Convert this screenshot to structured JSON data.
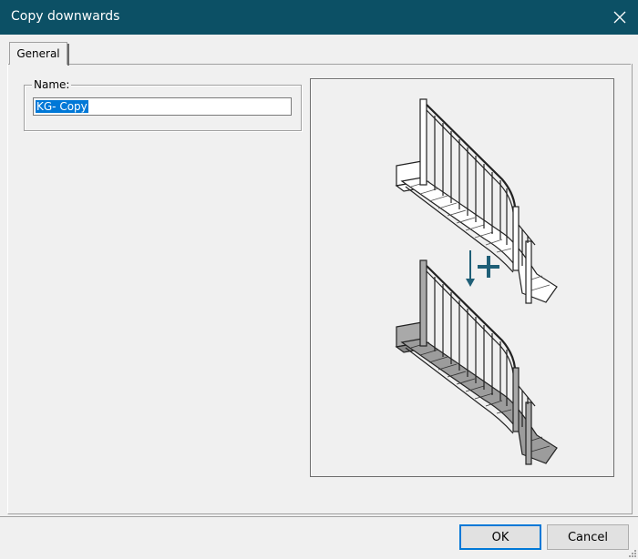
{
  "window": {
    "title": "Copy downwards",
    "titlebar_color": "#0c5065",
    "close_icon": "close-icon"
  },
  "tabs": [
    {
      "label": "General",
      "selected": true
    }
  ],
  "name_group": {
    "legend": "Name:",
    "value": "KG- Copy",
    "selection_color": "#0078d7"
  },
  "preview": {
    "description_icon": "copy-staircase-downwards-illustration",
    "arrow_icon": "down-arrow-icon",
    "plus_icon": "plus-icon",
    "accent": "#1f5f77"
  },
  "buttons": {
    "ok": "OK",
    "cancel": "Cancel"
  }
}
